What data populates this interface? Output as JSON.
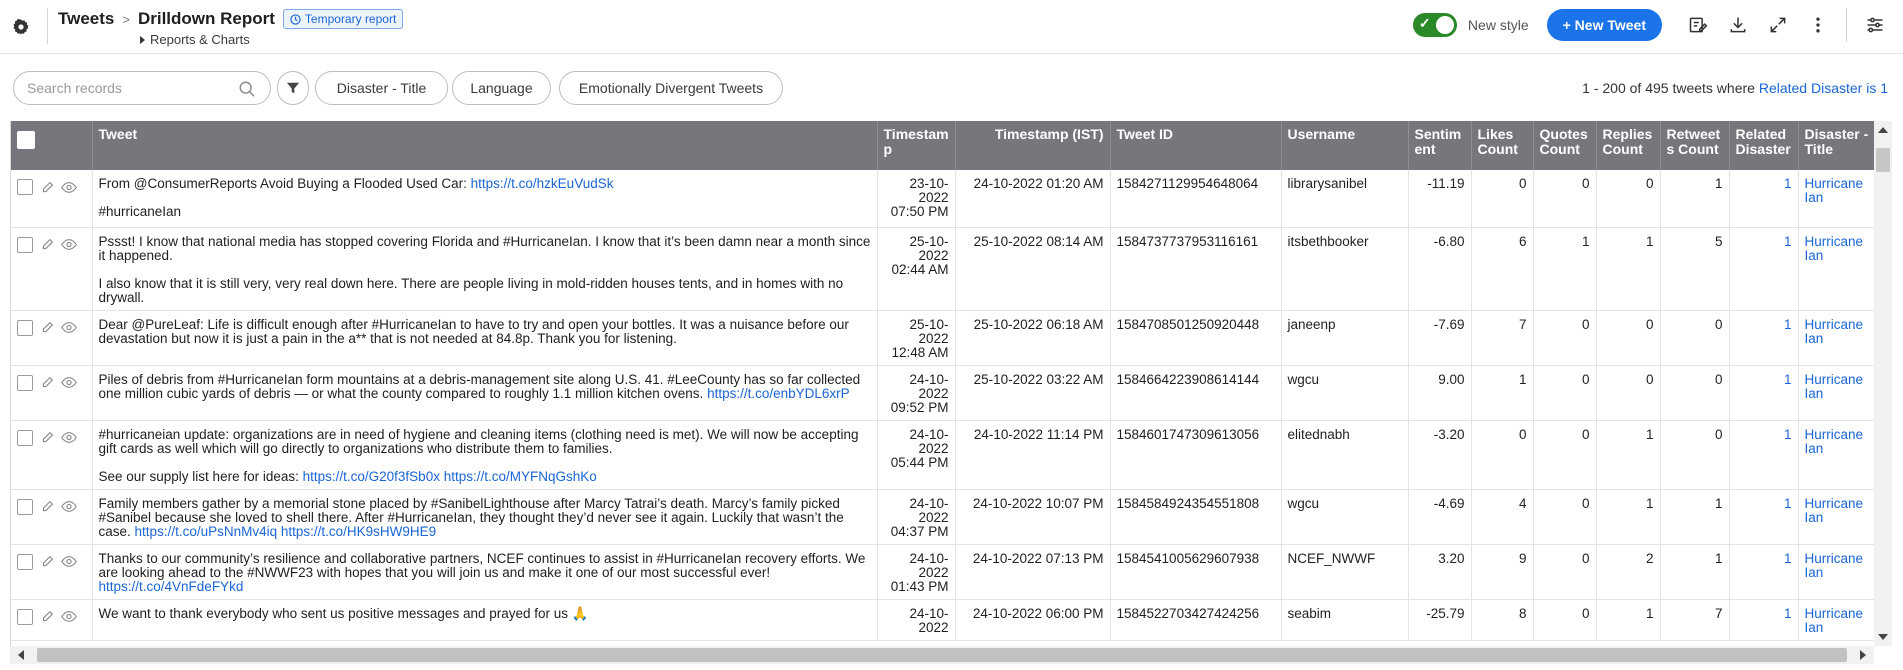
{
  "header": {
    "breadcrumb_root": "Tweets",
    "breadcrumb_sep": ">",
    "title": "Drilldown Report",
    "badge": "Temporary report",
    "sub_breadcrumb": "Reports & Charts",
    "new_style_label": "New style",
    "new_style_on": true,
    "new_button_label": "+ New Tweet",
    "icons": [
      "gear-icon",
      "edit-report-icon",
      "download-icon",
      "expand-icon",
      "more-vertical-icon",
      "settings-sliders-icon"
    ]
  },
  "toolbar": {
    "search_placeholder": "Search records",
    "filter_chips": [
      "Disaster - Title",
      "Language",
      "Emotionally Divergent Tweets"
    ],
    "record_count_prefix": "1 - 200 of 495 tweets where ",
    "record_count_link": "Related Disaster is 1"
  },
  "table": {
    "columns": [
      "Tweet",
      "Timestamp",
      "Timestamp (IST)",
      "Tweet ID",
      "Username",
      "Sentiment",
      "Likes Count",
      "Quotes Count",
      "Replies Count",
      "Retweets Count",
      "Related Disaster",
      "Disaster - Title"
    ],
    "column_display": [
      "Tweet",
      "Timestam p",
      "Timestamp (IST)",
      "Tweet ID",
      "Username",
      "Sentim ent",
      "Likes Count",
      "Quotes Count",
      "Replies Count",
      "Retweet s Count",
      "Related Disaster",
      "Disaster - Title"
    ],
    "rows": [
      {
        "tweet": [
          {
            "text": "From @ConsumerReports Avoid Buying a Flooded Used Car:",
            "link": "https://t.co/hzkEuVudSk"
          },
          {
            "text": "#hurricaneIan",
            "link": ""
          }
        ],
        "timestamp": "23-10-2022 07:50 PM",
        "timestamp_ist": "24-10-2022 01:20 AM",
        "tweet_id": "1584271129954648064",
        "username": "librarysanibel",
        "sentiment": "-11.19",
        "likes": "0",
        "quotes": "0",
        "replies": "0",
        "retweets": "1",
        "related": "1",
        "disaster": "Hurricane Ian"
      },
      {
        "tweet": [
          {
            "text": "Pssst! I know that national media has stopped covering Florida and #HurricaneIan. I know that it’s been damn near a month since it happened.",
            "link": ""
          },
          {
            "text": "I also know that it is still very, very real down here. There are people living in mold-ridden houses tents, and in homes with no drywall.",
            "link": ""
          }
        ],
        "timestamp": "25-10-2022 02:44 AM",
        "timestamp_ist": "25-10-2022 08:14 AM",
        "tweet_id": "1584737737953116161",
        "username": "itsbethbooker",
        "sentiment": "-6.80",
        "likes": "6",
        "quotes": "1",
        "replies": "1",
        "retweets": "5",
        "related": "1",
        "disaster": "Hurricane Ian"
      },
      {
        "tweet": [
          {
            "text": "Dear @PureLeaf: Life is difficult enough after #HurricaneIan to have to try and open your bottles. It was a nuisance before our devastation but now it is just a pain in the a** that is not needed at 84.8p. Thank you for listening.",
            "link": ""
          }
        ],
        "timestamp": "25-10-2022 12:48 AM",
        "timestamp_ist": "25-10-2022 06:18 AM",
        "tweet_id": "1584708501250920448",
        "username": "janeenp",
        "sentiment": "-7.69",
        "likes": "7",
        "quotes": "0",
        "replies": "0",
        "retweets": "0",
        "related": "1",
        "disaster": "Hurricane Ian"
      },
      {
        "tweet": [
          {
            "text": "Piles of debris from #HurricaneIan form mountains at a debris-management site along U.S. 41. #LeeCounty has so far collected one million cubic yards of debris — or what the county compared to roughly 1.1 million kitchen ovens.",
            "link": "https://t.co/enbYDL6xrP"
          }
        ],
        "timestamp": "24-10-2022 09:52 PM",
        "timestamp_ist": "25-10-2022 03:22 AM",
        "tweet_id": "1584664223908614144",
        "username": "wgcu",
        "sentiment": "9.00",
        "likes": "1",
        "quotes": "0",
        "replies": "0",
        "retweets": "0",
        "related": "1",
        "disaster": "Hurricane Ian"
      },
      {
        "tweet": [
          {
            "text": "#hurricaneian update: organizations are in need of hygiene and cleaning items (clothing need is met). We will now be accepting gift cards as well which will go directly to organizations who distribute them to families.",
            "link": ""
          },
          {
            "text": "See our supply list here for ideas:",
            "link": "https://t.co/G20f3fSb0x https://t.co/MYFNqGshKo"
          }
        ],
        "timestamp": "24-10-2022 05:44 PM",
        "timestamp_ist": "24-10-2022 11:14 PM",
        "tweet_id": "1584601747309613056",
        "username": "elitednabh",
        "sentiment": "-3.20",
        "likes": "0",
        "quotes": "0",
        "replies": "1",
        "retweets": "0",
        "related": "1",
        "disaster": "Hurricane Ian"
      },
      {
        "tweet": [
          {
            "text": "Family members gather by a memorial stone placed by #SanibelLighthouse after Marcy Tatrai’s death. Marcy’s family picked #Sanibel because she loved to shell there. After #HurricaneIan, they thought they’d never see it again. Luckily that wasn’t the case.",
            "link": "https://t.co/uPsNnMv4iq https://t.co/HK9sHW9HE9"
          }
        ],
        "timestamp": "24-10-2022 04:37 PM",
        "timestamp_ist": "24-10-2022 10:07 PM",
        "tweet_id": "1584584924354551808",
        "username": "wgcu",
        "sentiment": "-4.69",
        "likes": "4",
        "quotes": "0",
        "replies": "1",
        "retweets": "1",
        "related": "1",
        "disaster": "Hurricane Ian"
      },
      {
        "tweet": [
          {
            "text": "Thanks to our community’s resilience and collaborative partners, NCEF continues to assist in #HurricaneIan recovery efforts. We are looking ahead to the #NWWF23 with hopes that you will join us and make it one of our most successful ever!",
            "link": "https://t.co/4VnFdeFYkd"
          }
        ],
        "timestamp": "24-10-2022 01:43 PM",
        "timestamp_ist": "24-10-2022 07:13 PM",
        "tweet_id": "1584541005629607938",
        "username": "NCEF_NWWF",
        "sentiment": "3.20",
        "likes": "9",
        "quotes": "0",
        "replies": "2",
        "retweets": "1",
        "related": "1",
        "disaster": "Hurricane Ian"
      },
      {
        "tweet": [
          {
            "text": "We want to thank everybody who sent us positive messages and prayed for us 🙏",
            "link": ""
          }
        ],
        "timestamp": "24-10-2022",
        "timestamp_ist": "24-10-2022 06:00 PM",
        "tweet_id": "1584522703427424256",
        "username": "seabim",
        "sentiment": "-25.79",
        "likes": "8",
        "quotes": "0",
        "replies": "1",
        "retweets": "7",
        "related": "1",
        "disaster": "Hurricane Ian"
      }
    ]
  },
  "colors": {
    "accent": "#1a73e8",
    "header_bg": "#77767c",
    "link": "#1a66d6",
    "toggle_on": "#2a8a2a"
  }
}
